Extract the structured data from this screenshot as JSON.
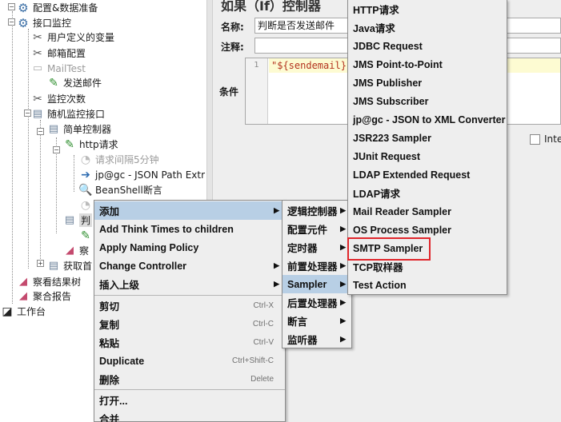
{
  "tree": {
    "items": [
      {
        "label": "配置&数据准备",
        "icon": "gear-icon"
      },
      {
        "label": "接口监控",
        "icon": "gear-icon"
      },
      {
        "label": "用户定义的变量",
        "icon": "wrench-scissors-icon"
      },
      {
        "label": "邮箱配置",
        "icon": "wrench-scissors-icon"
      },
      {
        "label": "MailTest",
        "icon": "disabled-element-icon"
      },
      {
        "label": "发送邮件",
        "icon": "pipette-icon"
      },
      {
        "label": "监控次数",
        "icon": "wrench-scissors-icon"
      },
      {
        "label": "随机监控接口",
        "icon": "controller-icon"
      },
      {
        "label": "简单控制器",
        "icon": "controller-icon"
      },
      {
        "label": "http请求",
        "icon": "pipette-icon"
      },
      {
        "label": "请求间隔5分钟",
        "icon": "timer-icon"
      },
      {
        "label": "jp@gc - JSON Path Extr",
        "icon": "extractor-arrow-icon"
      },
      {
        "label": "BeanShell断言",
        "icon": "magnifier-icon"
      },
      {
        "label": "",
        "icon": "timer-icon"
      },
      {
        "label": "判",
        "icon": "controller-icon"
      },
      {
        "label": "",
        "icon": "pipette-icon"
      },
      {
        "label": "察",
        "icon": "listener-chart-icon"
      },
      {
        "label": "获取首",
        "icon": "controller-icon"
      },
      {
        "label": "察看结果树",
        "icon": "listener-chart-icon"
      },
      {
        "label": "聚合报告",
        "icon": "listener-chart-icon"
      },
      {
        "label": "工作台",
        "icon": "workbench-icon"
      }
    ]
  },
  "panel": {
    "title": "如果（If）控制器",
    "name_label": "名称:",
    "name_value": "判断是否发送邮件",
    "comment_label": "注释:",
    "condition_label": "条件",
    "condition_line_no": "1",
    "condition_code": "\"${sendemail}\"",
    "interpret_checkbox_label": "Inte"
  },
  "context_menu": {
    "items": [
      {
        "label": "添加",
        "shortcut": "",
        "submenu": true
      },
      {
        "label": "Add Think Times to children",
        "shortcut": "",
        "submenu": false
      },
      {
        "label": "Apply Naming Policy",
        "shortcut": "",
        "submenu": false
      },
      {
        "label": "Change Controller",
        "shortcut": "",
        "submenu": true
      },
      {
        "label": "插入上级",
        "shortcut": "",
        "submenu": true
      },
      {
        "label": "剪切",
        "shortcut": "Ctrl-X",
        "submenu": false
      },
      {
        "label": "复制",
        "shortcut": "Ctrl-C",
        "submenu": false
      },
      {
        "label": "粘贴",
        "shortcut": "Ctrl-V",
        "submenu": false
      },
      {
        "label": "Duplicate",
        "shortcut": "Ctrl+Shift-C",
        "submenu": false
      },
      {
        "label": "删除",
        "shortcut": "Delete",
        "submenu": false
      },
      {
        "label": "打开...",
        "shortcut": "",
        "submenu": false
      },
      {
        "label": "合并",
        "shortcut": "",
        "submenu": false
      }
    ]
  },
  "add_submenu": {
    "items": [
      "逻辑控制器",
      "配置元件",
      "定时器",
      "前置处理器",
      "Sampler",
      "后置处理器",
      "断言",
      "监听器"
    ]
  },
  "sampler_submenu": {
    "items": [
      "HTTP请求",
      "Java请求",
      "JDBC Request",
      "JMS Point-to-Point",
      "JMS Publisher",
      "JMS Subscriber",
      "jp@gc - JSON to XML Converter",
      "JSR223 Sampler",
      "JUnit Request",
      "LDAP Extended Request",
      "LDAP请求",
      "Mail Reader Sampler",
      "OS Process Sampler",
      "SMTP Sampler",
      "TCP取样器",
      "Test Action"
    ]
  },
  "colors": {
    "menu_highlight": "#b8cfe5",
    "annotation_box": "#e0262b",
    "condition_text": "#b3331f"
  }
}
